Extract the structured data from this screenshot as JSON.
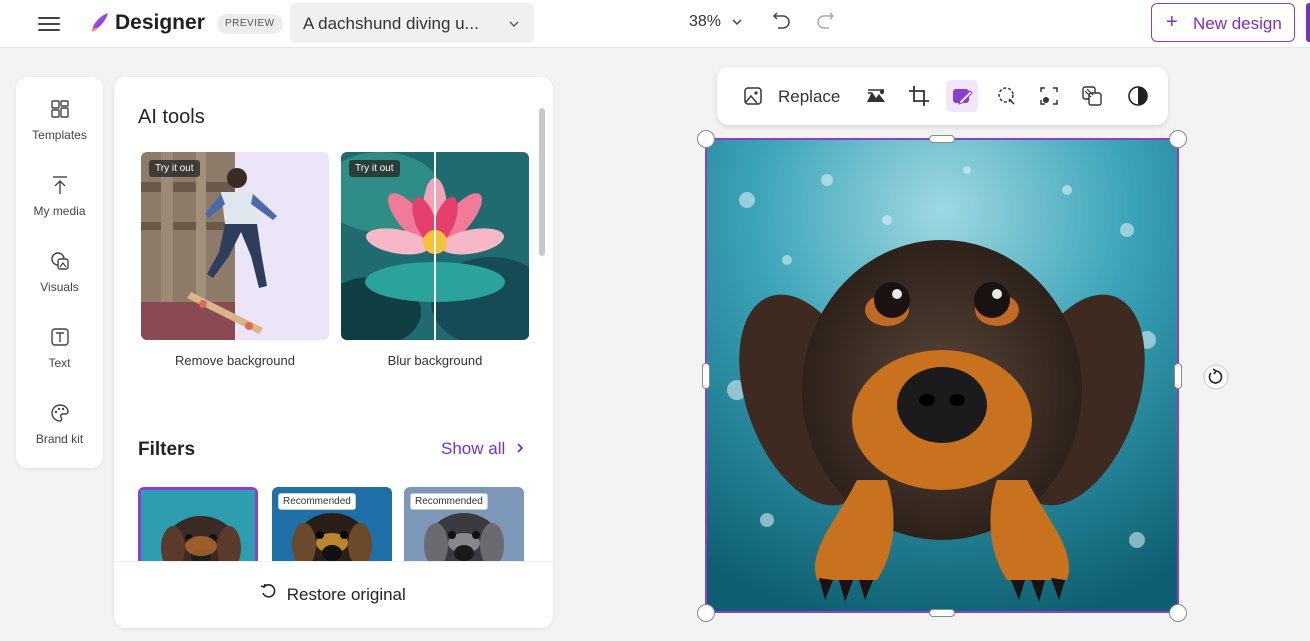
{
  "header": {
    "app_name": "Designer",
    "preview_badge": "PREVIEW",
    "doc_title": "A dachshund diving u...",
    "zoom": "38%",
    "new_design_label": "New design",
    "new_design_plus": "+"
  },
  "rail": {
    "items": [
      {
        "label": "Templates",
        "icon": "templates-icon"
      },
      {
        "label": "My media",
        "icon": "upload-icon"
      },
      {
        "label": "Visuals",
        "icon": "visuals-icon"
      },
      {
        "label": "Text",
        "icon": "text-icon"
      },
      {
        "label": "Brand kit",
        "icon": "palette-icon"
      }
    ]
  },
  "panel": {
    "title": "AI tools",
    "tools": [
      {
        "label": "Remove background",
        "tag": "Try it out"
      },
      {
        "label": "Blur background",
        "tag": "Try it out"
      }
    ],
    "filters_title": "Filters",
    "show_all": "Show all",
    "filters": [
      {
        "badge": ""
      },
      {
        "badge": "Recommended"
      },
      {
        "badge": "Recommended"
      }
    ],
    "restore_label": "Restore original"
  },
  "toolbar": {
    "replace_label": "Replace",
    "buttons": [
      "replace-icon",
      "effects-icon",
      "crop-icon",
      "edit-image-icon",
      "select-subject-icon",
      "frame-icon",
      "remove-bg-icon",
      "adjust-icon"
    ]
  },
  "colors": {
    "accent": "#8a3fd1",
    "accent_text": "#7b2fc7"
  }
}
